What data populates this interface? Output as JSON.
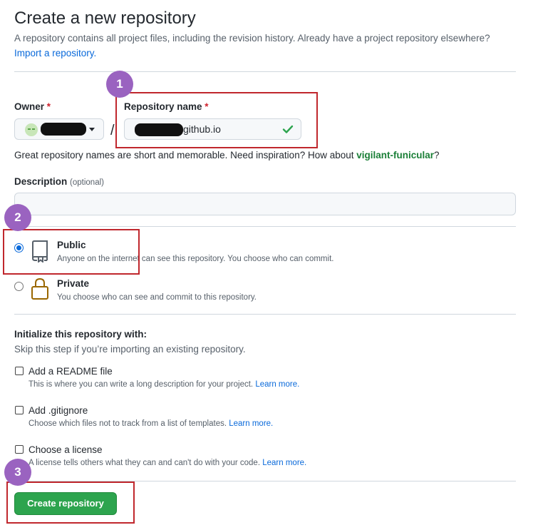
{
  "header": {
    "title": "Create a new repository",
    "subtitle": "A repository contains all project files, including the revision history. Already have a project repository elsewhere?",
    "import_link": "Import a repository."
  },
  "owner": {
    "label": "Owner",
    "required_mark": "*"
  },
  "repo_name": {
    "label": "Repository name",
    "required_mark": "*",
    "value": "github.io"
  },
  "hint": {
    "prefix": "Great repository names are short and memorable. Need inspiration? How about ",
    "suggestion": "vigilant-funicular",
    "suffix": "?"
  },
  "description": {
    "label": "Description",
    "optional": "(optional)"
  },
  "visibility": {
    "public": {
      "title": "Public",
      "desc": "Anyone on the internet can see this repository. You choose who can commit."
    },
    "private": {
      "title": "Private",
      "desc": "You choose who can see and commit to this repository."
    }
  },
  "init": {
    "heading": "Initialize this repository with:",
    "sub": "Skip this step if you’re importing an existing repository.",
    "items": [
      {
        "title": "Add a README file",
        "desc": "This is where you can write a long description for your project.",
        "link": "Learn more."
      },
      {
        "title": "Add .gitignore",
        "desc": "Choose which files not to track from a list of templates.",
        "link": "Learn more."
      },
      {
        "title": "Choose a license",
        "desc": "A license tells others what they can and can't do with your code.",
        "link": "Learn more."
      }
    ]
  },
  "create_button": "Create repository",
  "annotations": [
    "1",
    "2",
    "3"
  ],
  "colors": {
    "accent": "#0969da",
    "success": "#2da44e",
    "annotation_border": "#c0272d",
    "annotation_badge": "#9a63c0"
  }
}
